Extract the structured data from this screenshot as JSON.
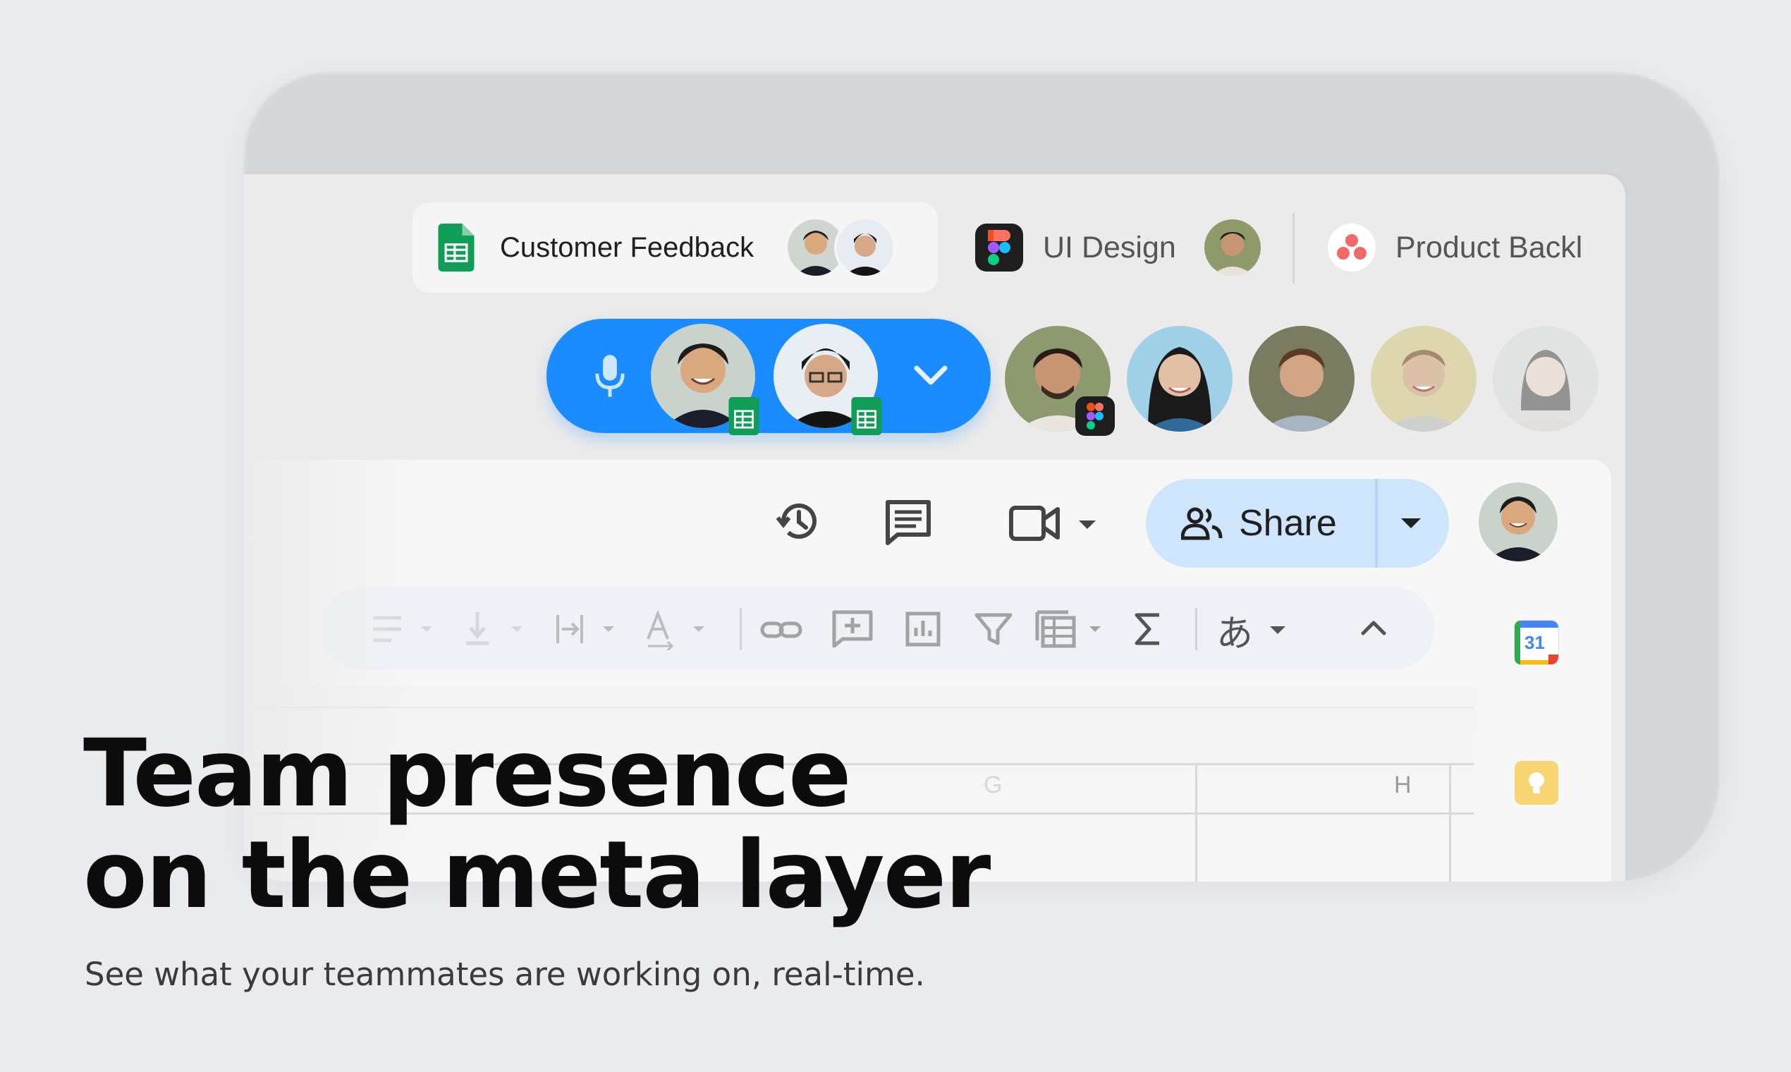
{
  "tabs": [
    {
      "label": "Customer Feedback",
      "app": "sheets-icon",
      "active": true
    },
    {
      "label": "UI Design",
      "app": "figma-icon",
      "active": false
    },
    {
      "label": "Product Backl",
      "app": "asana-icon",
      "active": false
    }
  ],
  "toolbar": {
    "share_label": "Share",
    "input_tool_label": "あ"
  },
  "sheet": {
    "col_g": "G",
    "col_h": "H"
  },
  "calendar": {
    "day": "31"
  },
  "marketing": {
    "headline_line1": "Team presence",
    "headline_line2": "on the meta layer",
    "subline": "See what your teammates are working on, real-time."
  },
  "colors": {
    "accent_blue": "#1a8cff",
    "share_bg": "#cfe5fb",
    "sheets_green": "#0f9d58"
  }
}
